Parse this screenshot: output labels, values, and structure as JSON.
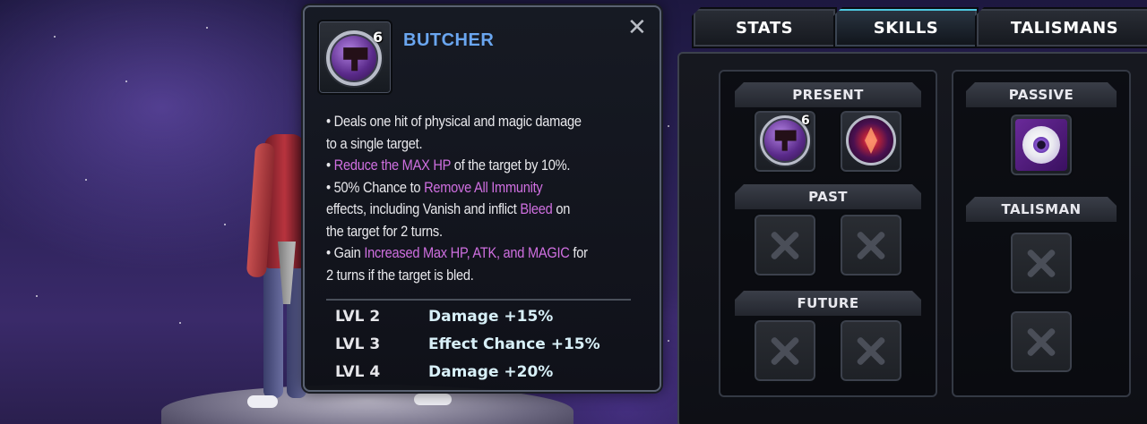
{
  "skill_tooltip": {
    "title": "BUTCHER",
    "level_badge": "6",
    "close_label": "✕",
    "description": [
      [
        {
          "t": "• Deals one hit of physical and magic damage"
        }
      ],
      [
        {
          "t": "to a single target."
        }
      ],
      [
        {
          "t": "• "
        },
        {
          "t": "Reduce the MAX HP",
          "hl": true
        },
        {
          "t": " of the target by 10%."
        }
      ],
      [
        {
          "t": "• 50% Chance to "
        },
        {
          "t": "Remove All Immunity",
          "hl": true
        }
      ],
      [
        {
          "t": "effects, including Vanish and inflict "
        },
        {
          "t": "Bleed",
          "hl": true
        },
        {
          "t": " on"
        }
      ],
      [
        {
          "t": "the target for 2 turns."
        }
      ],
      [
        {
          "t": "• Gain "
        },
        {
          "t": "Increased Max HP, ATK, and MAGIC",
          "hl": true
        },
        {
          "t": " for"
        }
      ],
      [
        {
          "t": "2 turns if the target is bled."
        }
      ]
    ],
    "levels": [
      {
        "level": "LVL 2",
        "effect": "Damage +15%"
      },
      {
        "level": "LVL 3",
        "effect": "Effect Chance +15%"
      },
      {
        "level": "LVL 4",
        "effect": "Damage +20%"
      }
    ],
    "highlight_color": "#cf6fe0",
    "title_color": "#6aa6f0"
  },
  "tabs": [
    {
      "label": "STATS",
      "active": false
    },
    {
      "label": "SKILLS",
      "active": true
    },
    {
      "label": "TALISMANS",
      "active": false
    }
  ],
  "skills_panel": {
    "present": {
      "label": "PRESENT",
      "skills": [
        {
          "icon": "cleaver-icon",
          "badge": "6"
        },
        {
          "icon": "crimson-sigil-icon"
        }
      ]
    },
    "past": {
      "label": "PAST",
      "slots": [
        "empty",
        "empty"
      ]
    },
    "future": {
      "label": "FUTURE",
      "slots": [
        "empty",
        "empty"
      ]
    },
    "passive": {
      "label": "PASSIVE",
      "icon": "eyeball-icon"
    },
    "talisman": {
      "label": "TALISMAN",
      "slots": [
        "empty",
        "empty"
      ]
    }
  }
}
